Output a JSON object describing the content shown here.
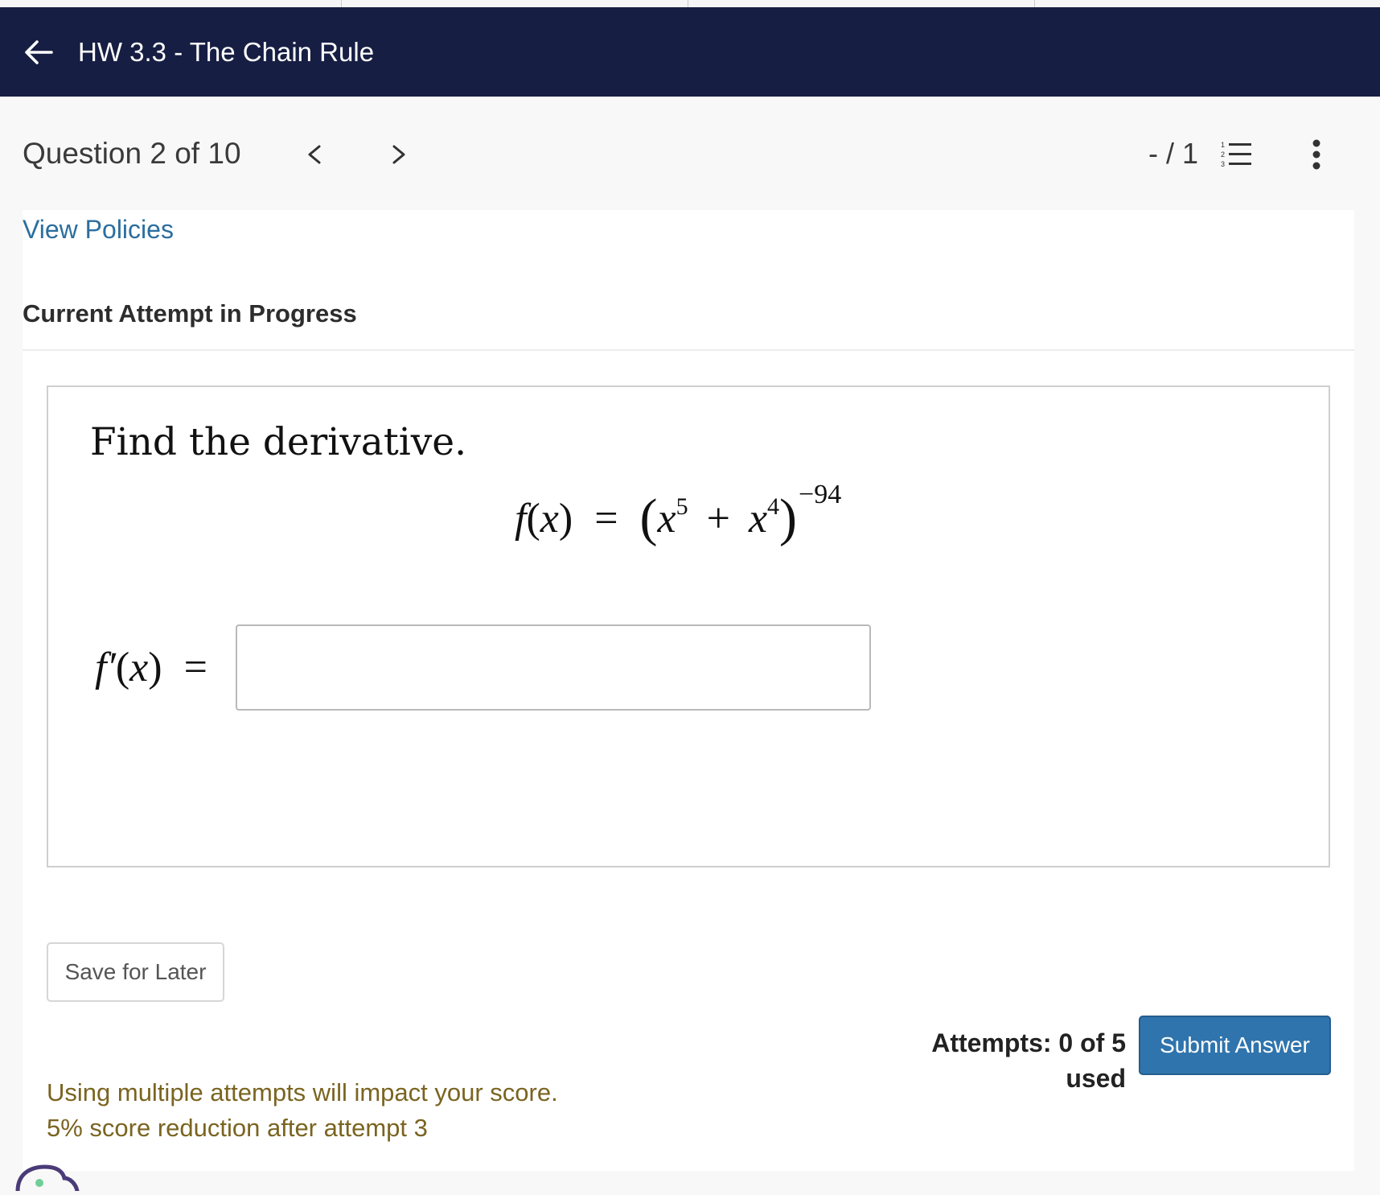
{
  "header": {
    "title": "HW 3.3 - The Chain Rule",
    "back_icon": "arrow-left-icon"
  },
  "subbar": {
    "question_label": "Question 2 of 10",
    "prev_icon": "chevron-left-icon",
    "next_icon": "chevron-right-icon",
    "score": "- / 1",
    "list_icon": "numbered-list-icon",
    "more_icon": "vertical-ellipsis-icon"
  },
  "content": {
    "policies_link": "View Policies",
    "attempt_heading": "Current Attempt in Progress"
  },
  "question": {
    "prompt": "Find the derivative.",
    "function_lhs": "f",
    "variable": "x",
    "base_term1_exponent": "5",
    "base_term2_exponent": "4",
    "outer_exponent": "−94",
    "derivative_lhs": "f′",
    "answer": {
      "value": "",
      "placeholder": ""
    }
  },
  "actions": {
    "save_label": "Save for Later",
    "attempts_text": "Attempts: 0 of 5 used",
    "submit_label": "Submit Answer"
  },
  "notes": {
    "line1": "Using multiple attempts will impact your score.",
    "line2": "5% score reduction after attempt 3"
  },
  "colors": {
    "header_bg": "#171e43",
    "link": "#2b6e9e",
    "primary_button": "#2f74ad",
    "warning_text": "#7a6420",
    "chat_widget": "#4a3b78",
    "chat_dot": "#6fcf97"
  }
}
